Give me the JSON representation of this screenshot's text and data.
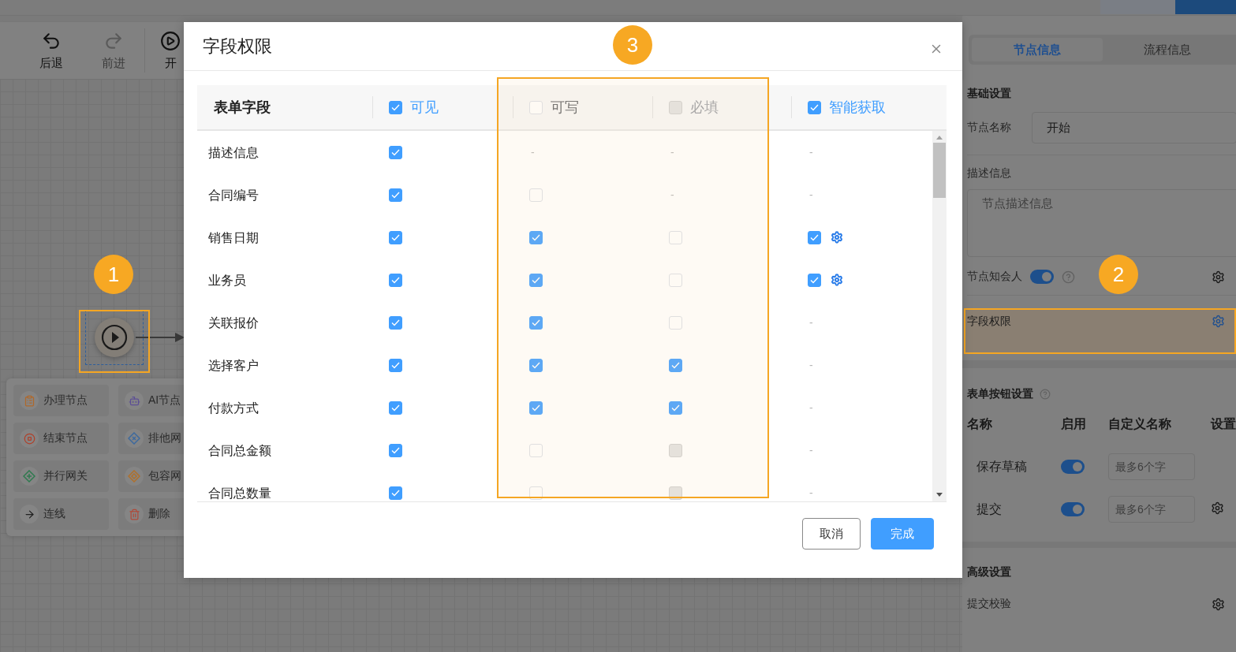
{
  "toolbar": {
    "items": [
      {
        "label": "后退",
        "kind": "undo",
        "disabled": false
      },
      {
        "label": "前进",
        "kind": "redo",
        "disabled": true
      },
      {
        "label": "开",
        "kind": "play",
        "disabled": false
      }
    ]
  },
  "canvas": {
    "start_node": {
      "selected": true
    },
    "node_menu": [
      {
        "label": "办理节点",
        "kind": "task"
      },
      {
        "label": "AI节点",
        "kind": "ai"
      },
      {
        "label": "结束节点",
        "kind": "end"
      },
      {
        "label": "排他网",
        "kind": "exclusive"
      },
      {
        "label": "并行网关",
        "kind": "parallel"
      },
      {
        "label": "包容网",
        "kind": "inclusive"
      },
      {
        "label": "连线",
        "kind": "connect"
      },
      {
        "label": "删除",
        "kind": "delete"
      }
    ]
  },
  "side_panel": {
    "tabs": [
      {
        "label": "节点信息",
        "selected": true
      },
      {
        "label": "流程信息",
        "selected": false
      }
    ],
    "basic": {
      "title": "基础设置",
      "name_label": "节点名称",
      "name_value": "开始",
      "desc_label": "描述信息",
      "desc_placeholder": "节点描述信息",
      "notify_label": "节点知会人",
      "notify_on": true,
      "field_perm_label": "字段权限"
    },
    "buttons_section": {
      "title": "表单按钮设置",
      "columns": [
        "名称",
        "启用",
        "自定义名称",
        "设置"
      ],
      "rows": [
        {
          "name": "保存草稿",
          "on": true,
          "placeholder": "最多6个字",
          "settings": false
        },
        {
          "name": "提交",
          "on": true,
          "placeholder": "最多6个字",
          "settings": true
        }
      ]
    },
    "advanced": {
      "title": "高级设置",
      "items": [
        {
          "label": "提交校验"
        }
      ]
    }
  },
  "modal": {
    "title": "字段权限",
    "columns": [
      {
        "label": "表单字段",
        "kind": "text"
      },
      {
        "label": "可见",
        "kind": "checkbox",
        "checked": true,
        "disabled": false
      },
      {
        "label": "可写",
        "kind": "checkbox",
        "checked": false,
        "disabled": false
      },
      {
        "label": "必填",
        "kind": "checkbox",
        "checked": false,
        "disabled": true
      },
      {
        "label": "智能获取",
        "kind": "checkbox",
        "checked": true,
        "disabled": false
      }
    ],
    "rows": [
      {
        "field": "描述信息",
        "cells": [
          {
            "kind": "checkbox",
            "checked": true,
            "disabled": false
          },
          {
            "kind": "dash",
            "text": "-"
          },
          {
            "kind": "dash",
            "text": "-"
          },
          {
            "kind": "dash",
            "text": "-"
          }
        ]
      },
      {
        "field": "合同编号",
        "cells": [
          {
            "kind": "checkbox",
            "checked": true,
            "disabled": false
          },
          {
            "kind": "checkbox",
            "checked": false,
            "disabled": false
          },
          {
            "kind": "dash",
            "text": "-"
          },
          {
            "kind": "dash",
            "text": "-"
          }
        ]
      },
      {
        "field": "销售日期",
        "cells": [
          {
            "kind": "checkbox",
            "checked": true,
            "disabled": false
          },
          {
            "kind": "checkbox",
            "checked": true,
            "disabled": false
          },
          {
            "kind": "checkbox",
            "checked": false,
            "disabled": false
          },
          {
            "kind": "checkbox-gear",
            "checked": true,
            "disabled": false
          }
        ]
      },
      {
        "field": "业务员",
        "cells": [
          {
            "kind": "checkbox",
            "checked": true,
            "disabled": false
          },
          {
            "kind": "checkbox",
            "checked": true,
            "disabled": false
          },
          {
            "kind": "checkbox",
            "checked": false,
            "disabled": false
          },
          {
            "kind": "checkbox-gear",
            "checked": true,
            "disabled": false
          }
        ]
      },
      {
        "field": "关联报价",
        "cells": [
          {
            "kind": "checkbox",
            "checked": true,
            "disabled": false
          },
          {
            "kind": "checkbox",
            "checked": true,
            "disabled": false
          },
          {
            "kind": "checkbox",
            "checked": false,
            "disabled": false
          },
          {
            "kind": "dash",
            "text": "-"
          }
        ]
      },
      {
        "field": "选择客户",
        "cells": [
          {
            "kind": "checkbox",
            "checked": true,
            "disabled": false
          },
          {
            "kind": "checkbox",
            "checked": true,
            "disabled": false
          },
          {
            "kind": "checkbox",
            "checked": true,
            "disabled": false
          },
          {
            "kind": "dash",
            "text": "-"
          }
        ]
      },
      {
        "field": "付款方式",
        "cells": [
          {
            "kind": "checkbox",
            "checked": true,
            "disabled": false
          },
          {
            "kind": "checkbox",
            "checked": true,
            "disabled": false
          },
          {
            "kind": "checkbox",
            "checked": true,
            "disabled": false
          },
          {
            "kind": "dash",
            "text": "-"
          }
        ]
      },
      {
        "field": "合同总金额",
        "cells": [
          {
            "kind": "checkbox",
            "checked": true,
            "disabled": false
          },
          {
            "kind": "checkbox",
            "checked": false,
            "disabled": false
          },
          {
            "kind": "checkbox",
            "checked": false,
            "disabled": true
          },
          {
            "kind": "dash",
            "text": "-"
          }
        ]
      },
      {
        "field": "合同总数量",
        "cells": [
          {
            "kind": "checkbox",
            "checked": true,
            "disabled": false
          },
          {
            "kind": "checkbox",
            "checked": false,
            "disabled": false
          },
          {
            "kind": "checkbox",
            "checked": false,
            "disabled": true
          },
          {
            "kind": "dash",
            "text": "-"
          }
        ]
      }
    ],
    "buttons": [
      {
        "label": "取消",
        "kind": "default"
      },
      {
        "label": "完成",
        "kind": "primary"
      }
    ]
  },
  "badges": [
    "1",
    "2",
    "3"
  ]
}
